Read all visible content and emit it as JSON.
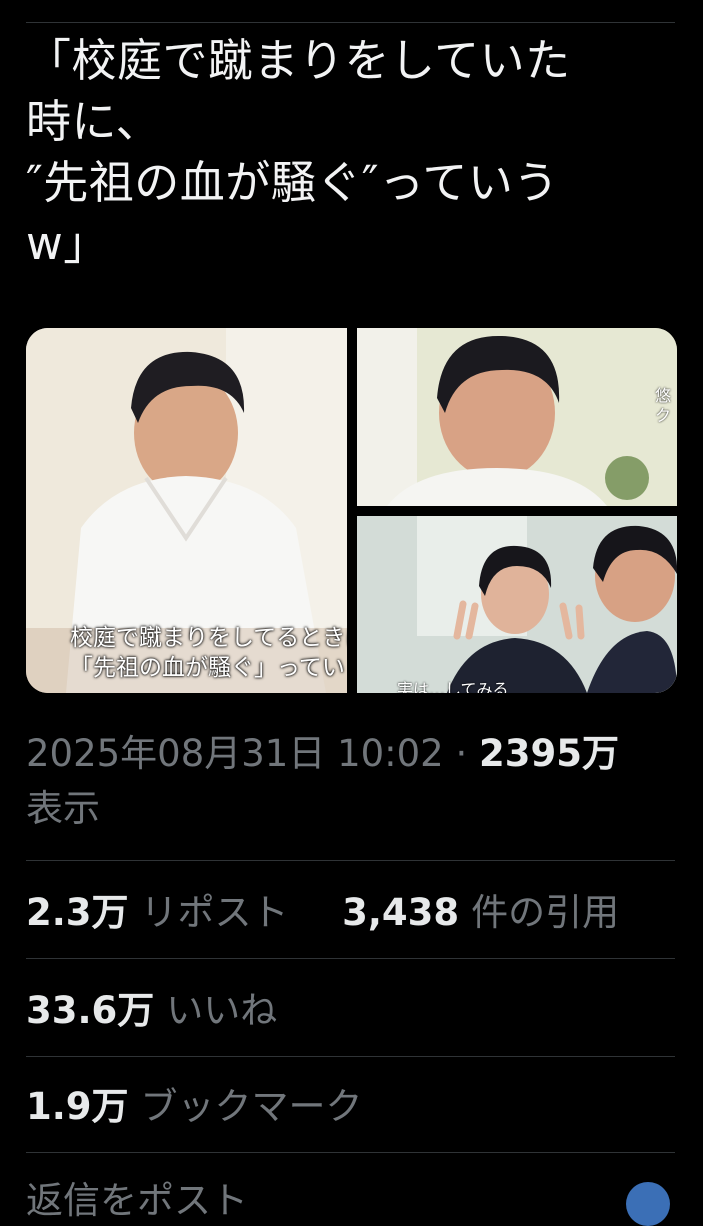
{
  "tweet": {
    "text_lines": [
      "「校庭で蹴まりをしていた",
      "時に、",
      "″先祖の血が騒ぐ″っていう",
      "w」"
    ]
  },
  "media": {
    "left_caption_1": "校庭で蹴まりをしてるときに",
    "left_caption_2": "「先祖の血が騒ぐ」ってい",
    "top_right_side_text": "悠\nク",
    "bottom_right_caption": "実は…してみる"
  },
  "meta": {
    "timestamp": "2025年08月31日 10:02",
    "separator": "·",
    "views_count": "2395万",
    "views_label": "表示"
  },
  "stats": {
    "reposts_count": "2.3万",
    "reposts_label": "リポスト",
    "quotes_count": "3,438",
    "quotes_label": "件の引用",
    "likes_count": "33.6万",
    "likes_label": "いいね",
    "bookmarks_count": "1.9万",
    "bookmarks_label": "ブックマーク"
  },
  "reply": {
    "placeholder_partial": "返信をポスト"
  },
  "colors": {
    "background": "#000000",
    "text_primary": "#e7e9ea",
    "text_secondary": "#71767b",
    "divider": "#2f3336"
  }
}
